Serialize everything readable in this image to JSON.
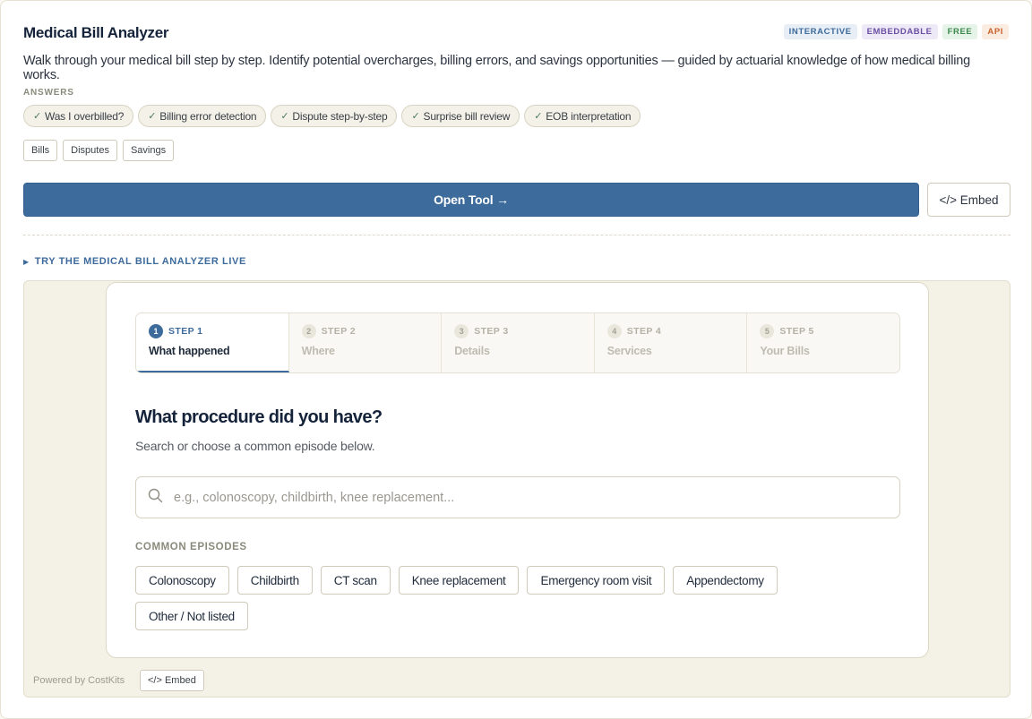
{
  "header": {
    "title": "Medical Bill Analyzer",
    "badges": [
      {
        "label": "INTERACTIVE",
        "color": "#3d6b9c",
        "bg": "#e8eef5"
      },
      {
        "label": "EMBEDDABLE",
        "color": "#6b4fa3",
        "bg": "#eee9f6"
      },
      {
        "label": "FREE",
        "color": "#3a8a4c",
        "bg": "#e6f3e8"
      },
      {
        "label": "API",
        "color": "#c8632d",
        "bg": "#fbece2"
      }
    ],
    "description": "Walk through your medical bill step by step. Identify potential overcharges, billing errors, and savings opportunities — guided by actuarial knowledge of how medical billing works."
  },
  "answers": {
    "heading": "ANSWERS",
    "items": [
      "Was I overbilled?",
      "Billing error detection",
      "Dispute step-by-step",
      "Surprise bill review",
      "EOB interpretation"
    ],
    "check": "✓"
  },
  "tags": [
    "Bills",
    "Disputes",
    "Savings"
  ],
  "actions": {
    "open_tool": "Open Tool →",
    "embed": "</> Embed"
  },
  "try_live": {
    "arrow": "▶",
    "label": "TRY THE MEDICAL BILL ANALYZER LIVE"
  },
  "widget": {
    "steps": [
      {
        "num": "1",
        "label": "STEP 1",
        "name": "What happened",
        "active": true
      },
      {
        "num": "2",
        "label": "STEP 2",
        "name": "Where",
        "active": false
      },
      {
        "num": "3",
        "label": "STEP 3",
        "name": "Details",
        "active": false
      },
      {
        "num": "4",
        "label": "STEP 4",
        "name": "Services",
        "active": false
      },
      {
        "num": "5",
        "label": "STEP 5",
        "name": "Your Bills",
        "active": false
      }
    ],
    "question": "What procedure did you have?",
    "subtitle": "Search or choose a common episode below.",
    "search": {
      "placeholder": "e.g., colonoscopy, childbirth, knee replacement...",
      "value": "",
      "icon": "search-icon"
    },
    "episodes_heading": "COMMON EPISODES",
    "episodes": [
      "Colonoscopy",
      "Childbirth",
      "CT scan",
      "Knee replacement",
      "Emergency room visit",
      "Appendectomy",
      "Other / Not listed"
    ]
  },
  "footer": {
    "powered_by": "Powered by CostKits",
    "embed": "</> Embed"
  },
  "colors": {
    "accent": "#3d6b9c",
    "background": "#f4f1e6"
  }
}
